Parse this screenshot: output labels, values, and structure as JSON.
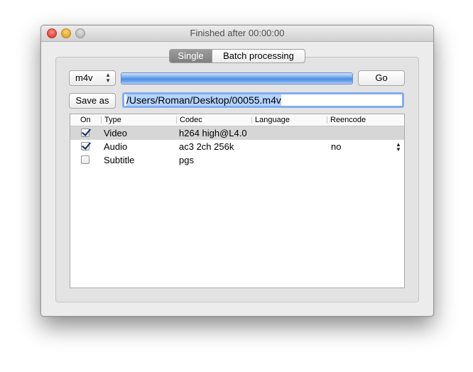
{
  "window": {
    "title": "Finished after 00:00:00"
  },
  "tabs": [
    {
      "label": "Single",
      "selected": true
    },
    {
      "label": "Batch processing",
      "selected": false
    }
  ],
  "format_popup": {
    "value": "m4v"
  },
  "progress": {
    "fraction": 1.0
  },
  "go_button": {
    "label": "Go"
  },
  "save_as_button": {
    "label": "Save as"
  },
  "output_path": {
    "value": "/Users/Roman/Desktop/00055.m4v"
  },
  "table": {
    "headers": [
      "On",
      "Type",
      "Codec",
      "Language",
      "Reencode"
    ],
    "rows": [
      {
        "on": true,
        "type": "Video",
        "codec": "h264 high@L4.0",
        "language": "",
        "reencode": ""
      },
      {
        "on": true,
        "type": "Audio",
        "codec": "ac3 2ch 256k",
        "language": "",
        "reencode": "no"
      },
      {
        "on": false,
        "type": "Subtitle",
        "codec": "pgs",
        "language": "",
        "reencode": ""
      }
    ]
  },
  "colors": {
    "accent": "#4d8fe3",
    "selected_row": "#d6d6d6",
    "checkmark": "#1b2a6b"
  }
}
